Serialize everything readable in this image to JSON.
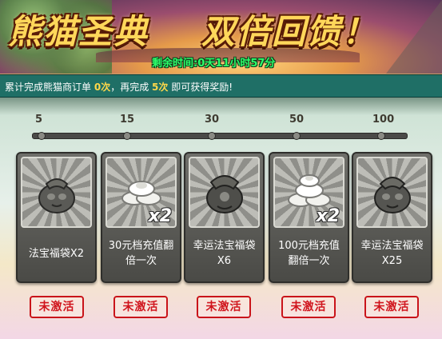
{
  "banner": {
    "title_left": "熊猫圣典",
    "title_right": "双倍回馈！",
    "timer": "剩余时间:0天11小时57分"
  },
  "info": {
    "prefix": "累计完成熊猫商订单",
    "done": "0次",
    "middle": "，再完成",
    "remaining": "5次",
    "suffix": "即可获得奖励!"
  },
  "progress": {
    "milestones": [
      "5",
      "15",
      "30",
      "50",
      "100"
    ],
    "completed": 0
  },
  "rewards": [
    {
      "label": "法宝福袋X2",
      "icon": "lucky-bag-icon",
      "multiplier": "",
      "status": "未激活"
    },
    {
      "label": "30元档充值翻倍一次",
      "icon": "silver-ingot-icon",
      "multiplier": "x2",
      "status": "未激活"
    },
    {
      "label": "幸运法宝福袋X6",
      "icon": "lucky-bag-icon",
      "multiplier": "",
      "status": "未激活"
    },
    {
      "label": "100元档充值翻倍一次",
      "icon": "silver-ingot-icon",
      "multiplier": "x2",
      "status": "未激活"
    },
    {
      "label": "幸运法宝福袋X25",
      "icon": "lucky-bag-icon",
      "multiplier": "",
      "status": "未激活"
    }
  ],
  "colors": {
    "title": "#ffd75a",
    "timer": "#2cff6a",
    "info_bar": "#1f6f66",
    "highlight_number": "#ffd84a",
    "stamp": "#d0141c"
  }
}
